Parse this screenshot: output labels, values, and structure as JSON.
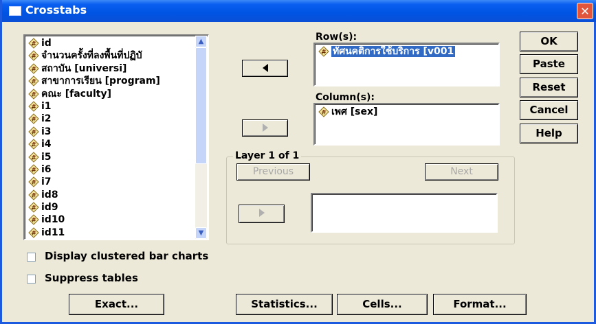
{
  "window": {
    "title": "Crosstabs"
  },
  "variables": [
    "id",
    "จำนวนครั้งที่ลงพื้นที่ปฏิบั",
    "สถาบัน [universi]",
    "สาขาการเรียน [program]",
    "คณะ [faculty]",
    "i1",
    "i2",
    "i3",
    "i4",
    "i5",
    "i6",
    "i7",
    "id8",
    "id9",
    "id10",
    "id11"
  ],
  "rows": {
    "label": "Row(s):",
    "items": [
      "ทัศนคติการใช้บริการ [v001"
    ]
  },
  "columns": {
    "label": "Column(s):",
    "items": [
      "เพศ [sex]"
    ]
  },
  "layer": {
    "label": "Layer 1 of 1",
    "previous": "Previous",
    "next": "Next"
  },
  "buttons": {
    "ok": "OK",
    "paste": "Paste",
    "reset": "Reset",
    "cancel": "Cancel",
    "help": "Help",
    "exact": "Exact...",
    "statistics": "Statistics...",
    "cells": "Cells...",
    "format": "Format..."
  },
  "options": {
    "clustered": "Display clustered bar charts",
    "suppress": "Suppress tables"
  },
  "icons": {
    "variable": "scale-variable-icon",
    "move_left": "left-arrow-icon",
    "move_right": "right-arrow-icon"
  }
}
